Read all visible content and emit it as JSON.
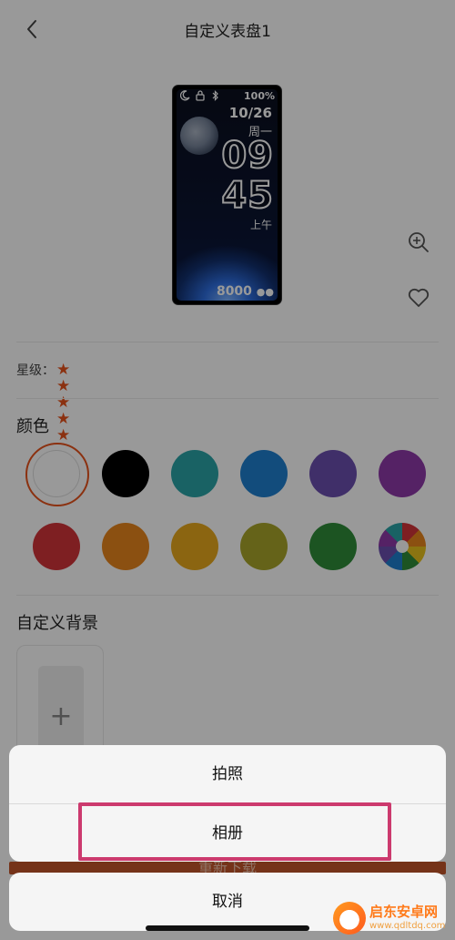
{
  "header": {
    "title": "自定义表盘1"
  },
  "watch": {
    "battery": "100%",
    "date": "10/26",
    "weekday": "周一",
    "hour": "09",
    "minute": "45",
    "ampm": "上午",
    "steps": "8000"
  },
  "rating": {
    "label": "星级：",
    "stars": 5
  },
  "colors": {
    "title": "颜色",
    "swatches": [
      "#ffffff",
      "#000000",
      "#2aa3a7",
      "#1e7fcf",
      "#6b4fb0",
      "#8e3aa8",
      "#d2343a",
      "#e8861d",
      "#e8a91d",
      "#a8a62a",
      "#2f8d3a",
      "multicolor"
    ],
    "selected_index": 0
  },
  "custom_bg": {
    "title": "自定义背景",
    "add_symbol": "+"
  },
  "download": {
    "label": "重新下载"
  },
  "action_sheet": {
    "take_photo": "拍照",
    "album": "相册",
    "cancel": "取消"
  },
  "watermark": {
    "name": "启东安卓网",
    "url": "www.qdltdq.com"
  }
}
